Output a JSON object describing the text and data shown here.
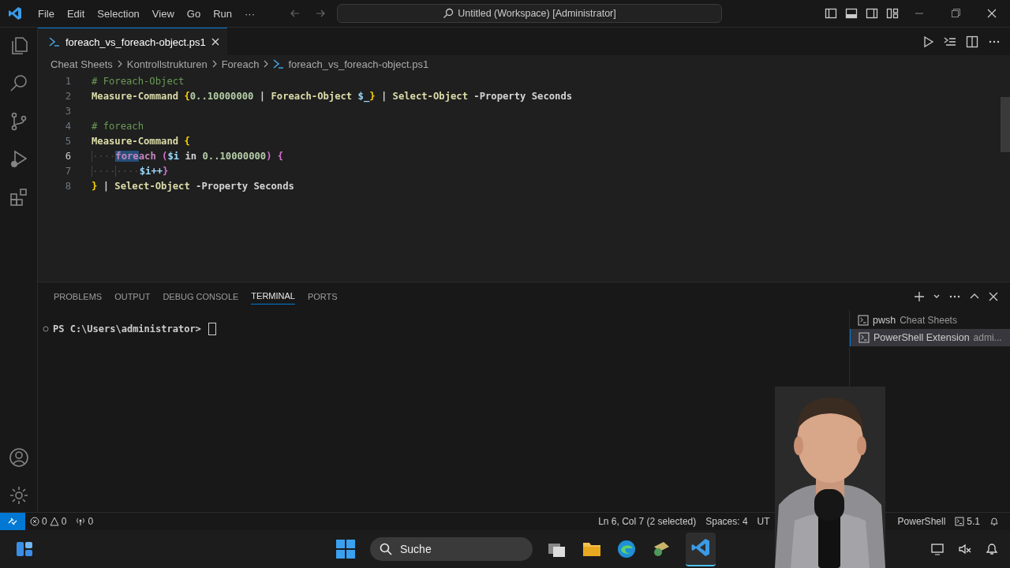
{
  "title_bar": {
    "menu": [
      "File",
      "Edit",
      "Selection",
      "View",
      "Go",
      "Run",
      "···"
    ],
    "command_center": "Untitled (Workspace) [Administrator]"
  },
  "editor_tabs": [
    {
      "label": "foreach_vs_foreach-object.ps1",
      "selected": true
    }
  ],
  "breadcrumb": [
    "Cheat Sheets",
    "Kontrollstrukturen",
    "Foreach",
    "foreach_vs_foreach-object.ps1"
  ],
  "code_lines": [
    {
      "number": "1",
      "tokens": [
        {
          "kind": "comment",
          "text": "# Foreach-Object"
        }
      ]
    },
    {
      "number": "2",
      "tokens": [
        {
          "kind": "cmdlet",
          "text": "Measure-Command "
        },
        {
          "kind": "brace",
          "text": "{"
        },
        {
          "kind": "number",
          "text": "0..10000000"
        },
        {
          "kind": "plain",
          "text": " | "
        },
        {
          "kind": "cmdlet",
          "text": "Foreach-Object "
        },
        {
          "kind": "variable",
          "text": "$_"
        },
        {
          "kind": "brace",
          "text": "}"
        },
        {
          "kind": "plain",
          "text": " | "
        },
        {
          "kind": "cmdlet",
          "text": "Select-Object "
        },
        {
          "kind": "plain",
          "text": "-Property Seconds"
        }
      ]
    },
    {
      "number": "3"
    },
    {
      "number": "4",
      "tokens": [
        {
          "kind": "comment",
          "text": "# foreach"
        }
      ]
    },
    {
      "number": "5",
      "tokens": [
        {
          "kind": "cmdlet",
          "text": "Measure-Command "
        },
        {
          "kind": "brace",
          "text": "{"
        }
      ]
    },
    {
      "number": "6",
      "tokens": [
        {
          "kind": "whitespace",
          "text": "····"
        },
        {
          "kind": "keyword",
          "text": "fore",
          "selected": true
        },
        {
          "kind": "keyword",
          "text": "ach",
          "selected": false
        },
        {
          "kind": "paren",
          "text": " ("
        },
        {
          "kind": "variable",
          "text": "$i"
        },
        {
          "kind": "plain",
          "text": " in "
        },
        {
          "kind": "number",
          "text": "0..10000000"
        },
        {
          "kind": "paren",
          "text": ") {"
        }
      ]
    },
    {
      "number": "7",
      "tokens": [
        {
          "kind": "whitespace",
          "text": "····"
        },
        {
          "kind": "whitespace",
          "text": "····"
        },
        {
          "kind": "variable",
          "text": "$i++"
        },
        {
          "kind": "paren",
          "text": "}"
        }
      ]
    },
    {
      "number": "8",
      "tokens": [
        {
          "kind": "brace",
          "text": "}"
        },
        {
          "kind": "plain",
          "text": " | "
        },
        {
          "kind": "cmdlet",
          "text": "Select-Object "
        },
        {
          "kind": "plain",
          "text": "-Property Seconds"
        }
      ]
    }
  ],
  "panel_tabs": [
    {
      "label": "PROBLEMS",
      "selected": false
    },
    {
      "label": "OUTPUT",
      "selected": false
    },
    {
      "label": "DEBUG CONSOLE",
      "selected": false
    },
    {
      "label": "TERMINAL",
      "selected": true
    },
    {
      "label": "PORTS",
      "selected": false
    }
  ],
  "terminal": {
    "prompt": "PS C:\\Users\\administrator>"
  },
  "terminal_list": [
    {
      "name": "pwsh",
      "detail": "Cheat Sheets",
      "selected": false
    },
    {
      "name": "PowerShell Extension",
      "detail": "admi...",
      "selected": true
    }
  ],
  "status_bar": {
    "errors": "0",
    "warnings": "0",
    "ports": "0",
    "position": "Ln 6, Col 7 (2 selected)",
    "spaces": "Spaces: 4",
    "encoding": "UT",
    "language": "PowerShell",
    "version": "5.1"
  },
  "taskbar": {
    "search": "Suche"
  },
  "webcam": {
    "kind": "picture"
  }
}
